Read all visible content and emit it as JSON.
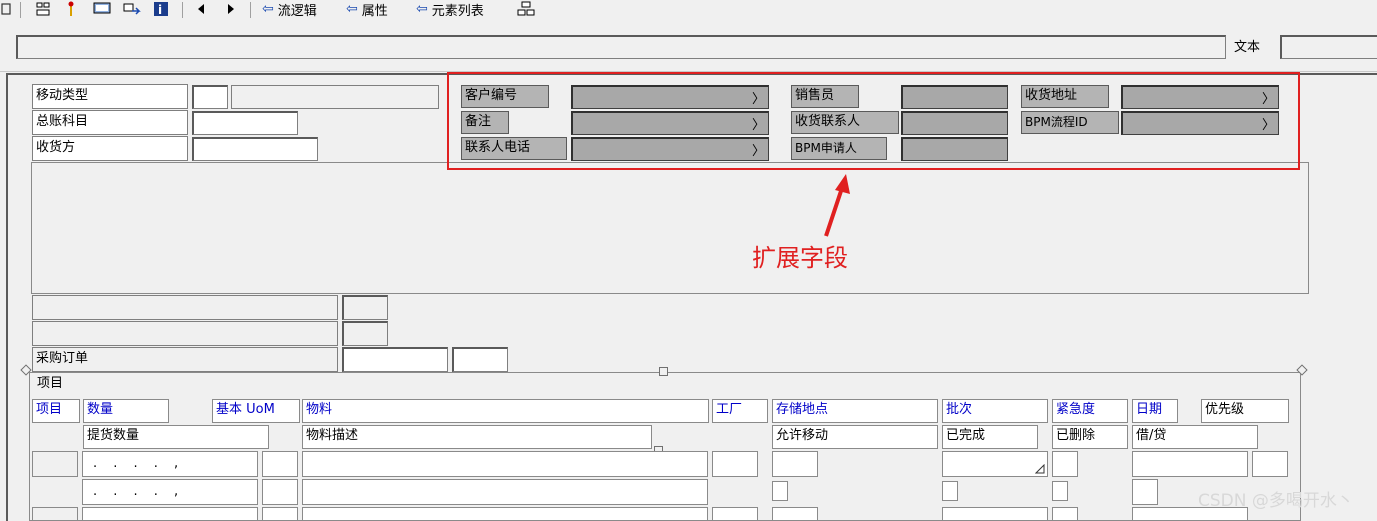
{
  "toolbar": {
    "icons": [
      "layout-icon",
      "hierarchy-icon",
      "pin-icon",
      "screen-icon",
      "transfer-icon",
      "info-icon"
    ],
    "links": [
      {
        "label": "流逻辑"
      },
      {
        "label": "属性"
      },
      {
        "label": "元素列表"
      }
    ]
  },
  "cmdbar": {
    "text_label": "文本"
  },
  "header": {
    "movement_type_label": "移动类型",
    "gl_account_label": "总账科目",
    "receiver_label": "收货方"
  },
  "ext_fields": {
    "customer_no_label": "客户编号",
    "remark_label": "备注",
    "contact_phone_label": "联系人电话",
    "salesperson_label": "销售员",
    "receiving_contact_label": "收货联系人",
    "bpm_applicant_label": "BPM申请人",
    "shipping_address_label": "收货地址",
    "bpm_process_id_label": "BPM流程ID"
  },
  "annotation": {
    "text": "扩展字段",
    "color": "#e02020"
  },
  "po": {
    "purchase_order_label": "采购订单"
  },
  "items": {
    "group_title": "项目",
    "columns_row1": [
      "项目",
      "数量",
      "基本 UoM",
      "物料",
      "工厂",
      "存储地点",
      "批次",
      "紧急度",
      "日期",
      "优先级"
    ],
    "columns_row2": [
      "提货数量",
      "物料描述",
      "允许移动",
      "已完成",
      "已删除",
      "借/贷"
    ],
    "rows": [
      {
        "qty": ". . . . ,"
      },
      {
        "qty": ". . . . ,"
      }
    ]
  },
  "watermark": "CSDN @多喝开水丶"
}
